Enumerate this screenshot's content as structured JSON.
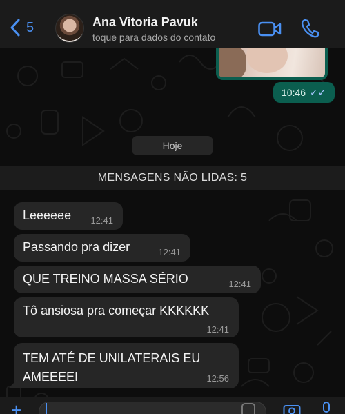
{
  "header": {
    "back_count": "5",
    "contact_name": "Ana Vitoria Pavuk",
    "contact_subtitle": "toque para dados do contato",
    "icons": {
      "back": "chevron-left-icon",
      "video": "video-camera-icon",
      "call": "phone-icon"
    }
  },
  "top_message": {
    "time": "10:46",
    "ticks": "✓✓",
    "status": "read"
  },
  "date_chip": "Hoje",
  "unread_banner": "MENSAGENS NÃO LIDAS: 5",
  "messages": [
    {
      "text": "Leeeeee",
      "time": "12:41"
    },
    {
      "text": "Passando pra dizer",
      "time": "12:41"
    },
    {
      "text": "QUE TREINO MASSA SÉRIO",
      "time": "12:41"
    },
    {
      "text": "Tô ansiosa pra começar KKKKKK",
      "time": "12:41"
    },
    {
      "text": "TEM ATÉ DE UNILATERAIS EU AMEEEEI",
      "time": "12:56"
    }
  ],
  "input_bar": {
    "icons": [
      "plus-icon",
      "sticker-icon",
      "camera-icon",
      "microphone-icon"
    ]
  },
  "colors": {
    "accent": "#4a90f2",
    "outgoing": "#0b5e4f",
    "incoming": "#262626",
    "background": "#0d0d0d"
  }
}
